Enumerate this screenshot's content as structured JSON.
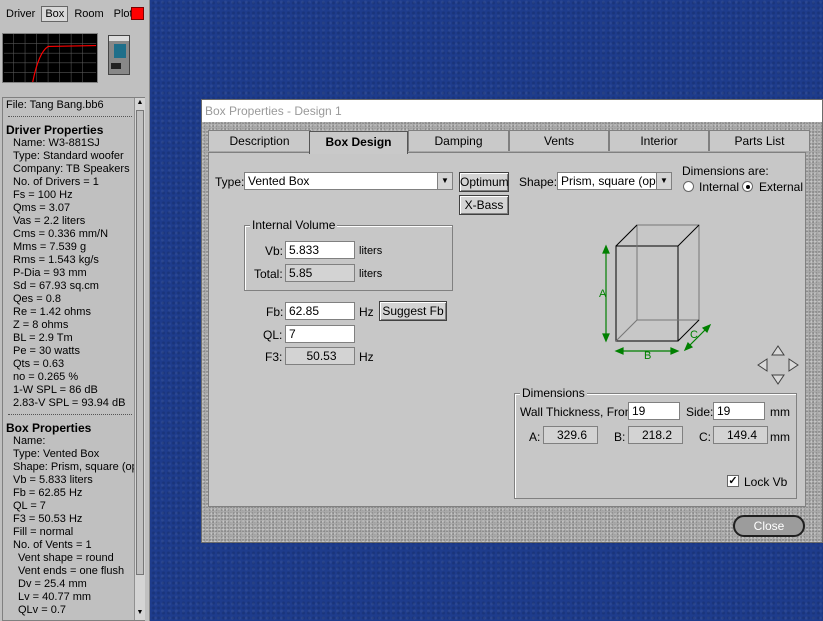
{
  "left_panel": {
    "tabs": [
      "Driver",
      "Box",
      "Room",
      "Plot"
    ],
    "active_tab": "Box",
    "plot_color": "#ff0000",
    "file": "File: Tang Bang.bb6",
    "driver_header": "Driver Properties",
    "driver_lines": [
      "Name:  W3-881SJ",
      "Type: Standard woofer",
      "Company: TB Speakers",
      "No. of Drivers = 1",
      "Fs  =  100 Hz",
      "Qms  =  3.07",
      "Vas  =  2.2 liters",
      "Cms  =  0.336 mm/N",
      "Mms  =  7.539 g",
      "Rms  =  1.543 kg/s",
      "P-Dia  =  93 mm",
      "Sd  =  67.93 sq.cm",
      "Qes  =  0.8",
      "Re  =  1.42 ohms",
      "Z  =  8 ohms",
      "BL  =  2.9 Tm",
      "Pe  =  30 watts",
      "Qts  =  0.63",
      "no  =  0.265 %",
      "1-W SPL  =  86 dB",
      "2.83-V SPL  =  93.94 dB"
    ],
    "box_header": "Box Properties",
    "box_lines": [
      "Name:",
      "Type: Vented Box",
      "Shape: Prism, square (opt",
      "Vb  =  5.833 liters",
      "Fb  =  62.85 Hz",
      "QL  =  7",
      "F3  =  50.53 Hz",
      "Fill = normal",
      "No. of Vents = 1"
    ],
    "vent_lines": [
      "Vent shape = round",
      "Vent ends = one flush",
      "Dv  =  25.4 mm",
      "Lv  =  40.77 mm",
      "QLv  =  0.7"
    ]
  },
  "dialog": {
    "title": "Box Properties - Design 1",
    "tabs": [
      "Description",
      "Box Design",
      "Damping",
      "Vents",
      "Interior",
      "Parts List"
    ],
    "active_tab": "Box Design",
    "type_label": "Type:",
    "type_value": "Vented Box",
    "optimum_label": "Optimum",
    "xbass_label": "X-Bass",
    "shape_label": "Shape:",
    "shape_value": "Prism, square (opt.)",
    "dimensions_are_label": "Dimensions are:",
    "internal_label": "Internal",
    "external_label": "External",
    "selected_dimensions": "External",
    "internal_volume_title": "Internal Volume",
    "vb_label": "Vb:",
    "vb_value": "5.833",
    "vb_unit": "liters",
    "total_label": "Total:",
    "total_value": "5.85",
    "total_unit": "liters",
    "fb_label": "Fb:",
    "fb_value": "62.85",
    "fb_unit": "Hz",
    "suggest_fb_label": "Suggest Fb",
    "ql_label": "QL:",
    "ql_value": "7",
    "f3_label": "F3:",
    "f3_value": "50.53",
    "f3_unit": "Hz",
    "box_diagram": {
      "label_a": "A",
      "label_b": "B",
      "label_c": "C",
      "dim_color": "#008000"
    },
    "dimensions_title": "Dimensions",
    "wall_thickness_label": "Wall Thickness, Front:",
    "front_value": "19",
    "side_label": "Side:",
    "side_value": "19",
    "mm_unit": "mm",
    "a_label": "A:",
    "a_value": "329.6",
    "b_label": "B:",
    "b_value": "218.2",
    "c_label": "C:",
    "c_value": "149.4",
    "lock_vb_label": "Lock Vb",
    "lock_vb_checked": true,
    "close_label": "Close"
  }
}
